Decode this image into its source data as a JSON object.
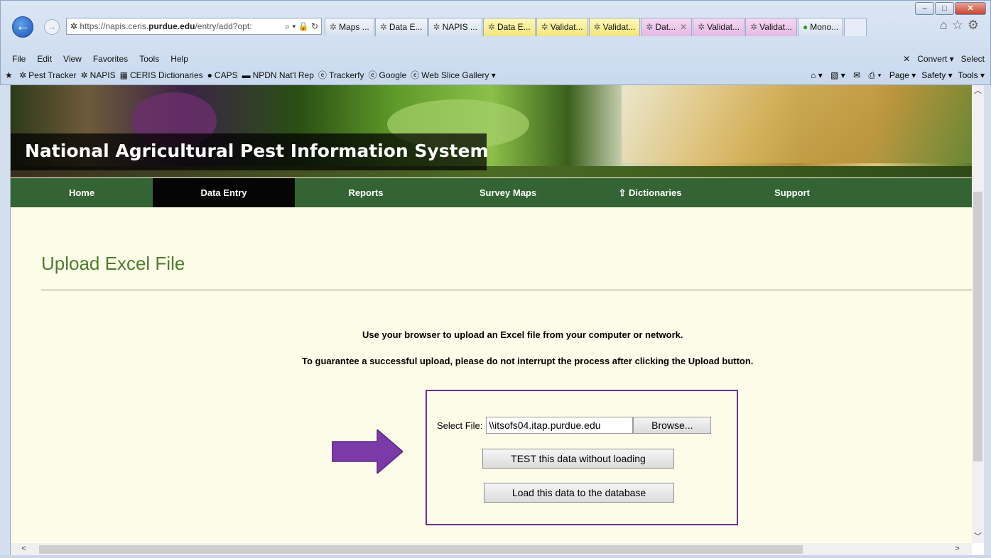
{
  "browser": {
    "window_buttons": {
      "minimize": "–",
      "maximize": "□",
      "close": "✕"
    },
    "address_prefix": "https://napis.ceris.",
    "address_domain": "purdue.edu",
    "address_rest": "/entry/add?opt:",
    "address_controls": "⌕ ▾ 🔒 ↻",
    "tabs": [
      {
        "label": "Maps ...",
        "style": "normal"
      },
      {
        "label": "Data E...",
        "style": "normal"
      },
      {
        "label": "NAPIS ...",
        "style": "normal"
      },
      {
        "label": "Data E...",
        "style": "yellow"
      },
      {
        "label": "Validat...",
        "style": "yellow"
      },
      {
        "label": "Validat...",
        "style": "yellow"
      },
      {
        "label": "Dat...",
        "style": "active-pink"
      },
      {
        "label": "Validat...",
        "style": "pink"
      },
      {
        "label": "Validat...",
        "style": "pink"
      },
      {
        "label": "Mono...",
        "style": "green"
      }
    ],
    "menu": [
      "File",
      "Edit",
      "View",
      "Favorites",
      "Tools",
      "Help"
    ],
    "menu_right": [
      "✕",
      "Convert ▾",
      "Select"
    ],
    "favorites": [
      "Pest Tracker",
      "NAPIS",
      "CERIS Dictionaries",
      "CAPS",
      "NPDN Nat'l Rep",
      "Trackerfy",
      "Google",
      "Web Slice Gallery ▾"
    ],
    "command_bar": [
      "Page ▾",
      "Safety ▾",
      "Tools ▾"
    ]
  },
  "site": {
    "title": "National Agricultural Pest Information System",
    "nav": [
      {
        "label": "Home",
        "active": false
      },
      {
        "label": "Data Entry",
        "active": true
      },
      {
        "label": "Reports",
        "active": false
      },
      {
        "label": "Survey Maps",
        "active": false
      },
      {
        "label": "⇧ Dictionaries",
        "active": false
      },
      {
        "label": "Support",
        "active": false
      }
    ]
  },
  "page": {
    "heading": "Upload Excel File",
    "info_line_1": "Use your browser to upload an Excel file from your computer or network.",
    "info_line_2": "To guarantee a successful upload, please do not interrupt the process after clicking the Upload button.",
    "select_label": "Select File:",
    "file_value": "\\\\itsofs04.itap.purdue.edu",
    "browse_label": "Browse...",
    "test_button": "TEST this data without loading",
    "load_button": "Load this data to the database"
  },
  "colors": {
    "nav_green": "#346434",
    "heading_green": "#4e7d2c",
    "box_purple": "#6f3097",
    "arrow_purple": "#7b3aa8",
    "page_bg": "#fcfce9"
  }
}
